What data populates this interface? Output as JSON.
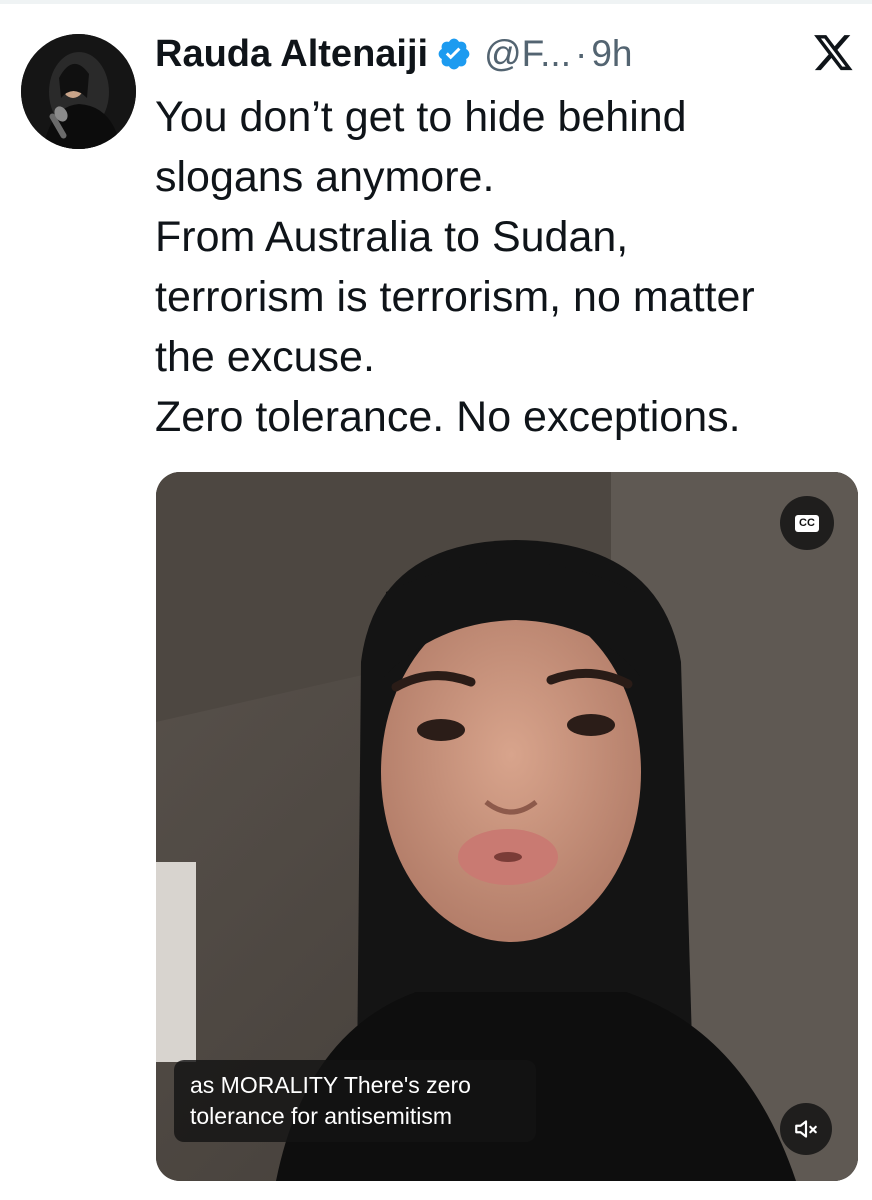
{
  "tweet": {
    "author": {
      "display_name": "Rauda Altenaiji",
      "handle": "@F...",
      "verified": true,
      "avatar_icon": "avatar-photo"
    },
    "separator": "·",
    "time": "9h",
    "platform_icon": "x-logo-icon",
    "text_lines": [
      "You don’t get to hide behind",
      "slogans anymore.",
      "From Australia to Sudan,",
      "terrorism is terrorism, no matter",
      "the excuse.",
      "Zero tolerance. No exceptions."
    ]
  },
  "video": {
    "cc_icon_text": "CC",
    "caption_lines": [
      "as MORALITY There's zero",
      "tolerance for antisemitism"
    ],
    "mute_icon": "speaker-muted-icon"
  },
  "colors": {
    "text_primary": "#0f1419",
    "text_secondary": "#536471",
    "verified_blue": "#1d9bf0"
  }
}
